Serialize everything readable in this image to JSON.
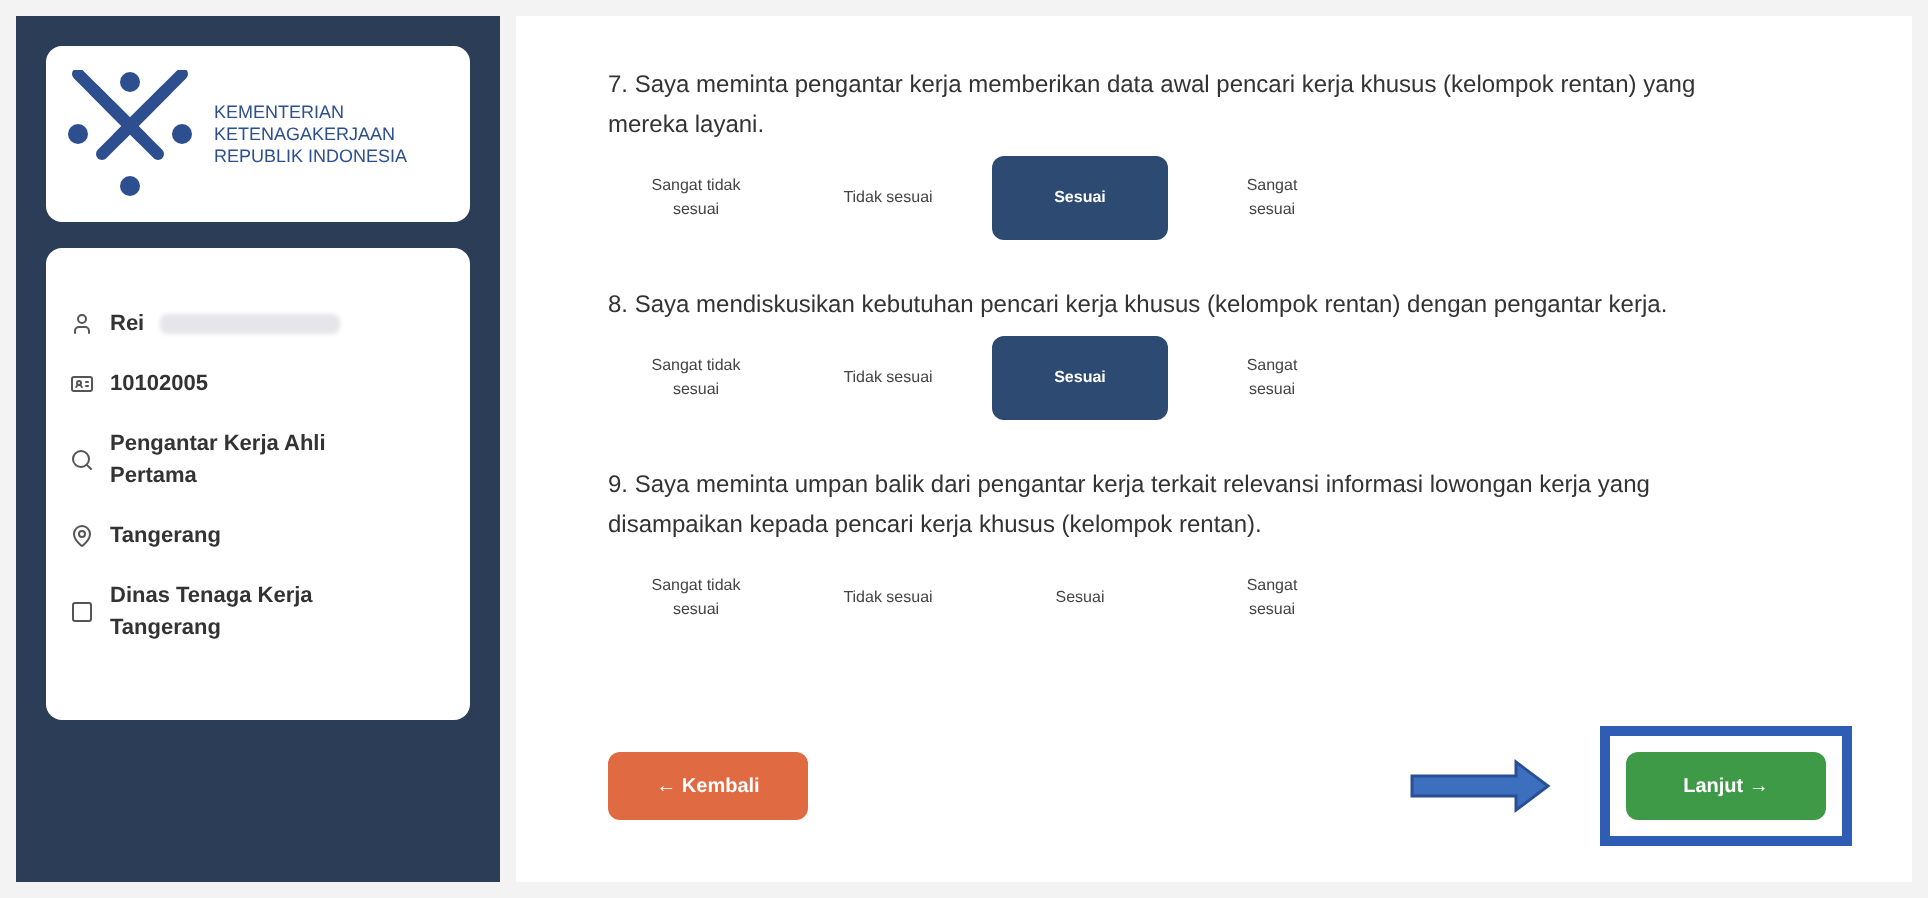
{
  "sidebar": {
    "logo_lines": [
      "KEMENTERIAN",
      "KETENAGAKERJAAN",
      "REPUBLIK INDONESIA"
    ],
    "profile": [
      {
        "kind": "person",
        "text": "Rei",
        "redacted": true
      },
      {
        "kind": "id",
        "text": "10102005",
        "redacted": false
      },
      {
        "kind": "role",
        "text": "Pengantar Kerja Ahli Pertama",
        "redacted": false
      },
      {
        "kind": "location",
        "text": "Tangerang",
        "redacted": false
      },
      {
        "kind": "office",
        "text": "Dinas Tenaga Kerja Tangerang",
        "redacted": false
      }
    ]
  },
  "questions": [
    {
      "text": "7. Saya meminta pengantar kerja memberikan data awal pencari kerja khusus (kelompok rentan) yang mereka layani.",
      "options": [
        {
          "label": "Sangat tidak sesuai",
          "selected": false
        },
        {
          "label": "Tidak sesuai",
          "selected": false
        },
        {
          "label": "Sesuai",
          "selected": true
        },
        {
          "label": "Sangat sesuai",
          "selected": false
        }
      ]
    },
    {
      "text": "8. Saya mendiskusikan kebutuhan pencari kerja khusus (kelompok rentan) dengan pengantar kerja.",
      "options": [
        {
          "label": "Sangat tidak sesuai",
          "selected": false
        },
        {
          "label": "Tidak sesuai",
          "selected": false
        },
        {
          "label": "Sesuai",
          "selected": true
        },
        {
          "label": "Sangat sesuai",
          "selected": false
        }
      ]
    },
    {
      "text": "9. Saya meminta umpan balik dari pengantar kerja terkait relevansi informasi lowongan kerja yang disampaikan kepada pencari kerja khusus (kelompok rentan).",
      "options": [
        {
          "label": "Sangat tidak sesuai",
          "selected": false
        },
        {
          "label": "Tidak sesuai",
          "selected": false
        },
        {
          "label": "Sesuai",
          "selected": false
        },
        {
          "label": "Sangat sesuai",
          "selected": false
        }
      ]
    }
  ],
  "back_button": "← Kembali",
  "next_button": "Lanjut →",
  "next_highlighted": true
}
